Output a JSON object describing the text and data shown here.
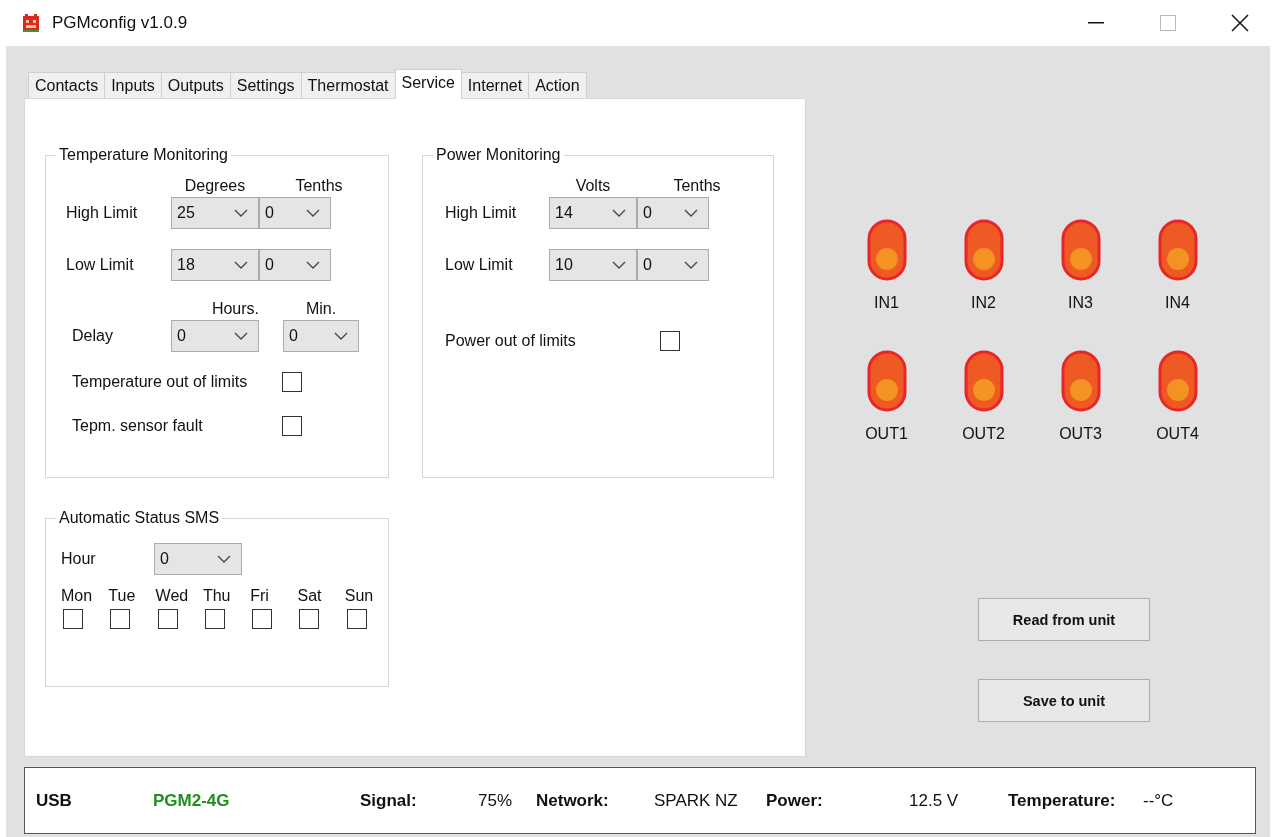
{
  "window": {
    "title": "PGMconfig v1.0.9"
  },
  "tabs": [
    {
      "label": "Contacts",
      "selected": false
    },
    {
      "label": "Inputs",
      "selected": false
    },
    {
      "label": "Outputs",
      "selected": false
    },
    {
      "label": "Settings",
      "selected": false
    },
    {
      "label": "Thermostat",
      "selected": false
    },
    {
      "label": "Service",
      "selected": true
    },
    {
      "label": "Internet",
      "selected": false
    },
    {
      "label": "Action",
      "selected": false
    }
  ],
  "temperature_monitoring": {
    "title": "Temperature Monitoring",
    "limit_headers": [
      "Degrees",
      "Tenths"
    ],
    "limits": [
      {
        "label": "High Limit",
        "values": [
          "25",
          "0"
        ]
      },
      {
        "label": "Low Limit",
        "values": [
          "18",
          "0"
        ]
      }
    ],
    "delay_headers": [
      "Hours.",
      "Min."
    ],
    "delay": {
      "label": "Delay",
      "values": [
        "0",
        "0"
      ]
    },
    "checks": [
      {
        "label": "Temperature out of limits",
        "checked": false
      },
      {
        "label": "Tepm. sensor fault",
        "checked": false
      }
    ]
  },
  "power_monitoring": {
    "title": "Power Monitoring",
    "limit_headers": [
      "Volts",
      "Tenths"
    ],
    "limits": [
      {
        "label": "High Limit",
        "values": [
          "14",
          "0"
        ]
      },
      {
        "label": "Low Limit",
        "values": [
          "10",
          "0"
        ]
      }
    ],
    "checks": [
      {
        "label": "Power out of limits",
        "checked": false
      }
    ]
  },
  "automatic_status_sms": {
    "title": "Automatic Status SMS",
    "hour": {
      "label": "Hour",
      "value": "0"
    },
    "days": [
      {
        "label": "Mon",
        "checked": false
      },
      {
        "label": "Tue",
        "checked": false
      },
      {
        "label": "Wed",
        "checked": false
      },
      {
        "label": "Thu",
        "checked": false
      },
      {
        "label": "Fri",
        "checked": false
      },
      {
        "label": "Sat",
        "checked": false
      },
      {
        "label": "Sun",
        "checked": false
      }
    ]
  },
  "inputs": [
    {
      "label": "IN1",
      "on": false
    },
    {
      "label": "IN2",
      "on": false
    },
    {
      "label": "IN3",
      "on": false
    },
    {
      "label": "IN4",
      "on": false
    }
  ],
  "outputs": [
    {
      "label": "OUT1",
      "on": false
    },
    {
      "label": "OUT2",
      "on": false
    },
    {
      "label": "OUT3",
      "on": false
    },
    {
      "label": "OUT4",
      "on": false
    }
  ],
  "buttons": [
    "Read from unit",
    "Save to unit"
  ],
  "status_bar": {
    "connection": "USB",
    "device": "PGM2-4G",
    "fields": [
      {
        "label": "Signal:",
        "value": "75%"
      },
      {
        "label": "Network:",
        "value": "SPARK NZ"
      },
      {
        "label": "Power:",
        "value": "12.5 V"
      },
      {
        "label": "Temperature:",
        "value": "--°C"
      }
    ]
  }
}
